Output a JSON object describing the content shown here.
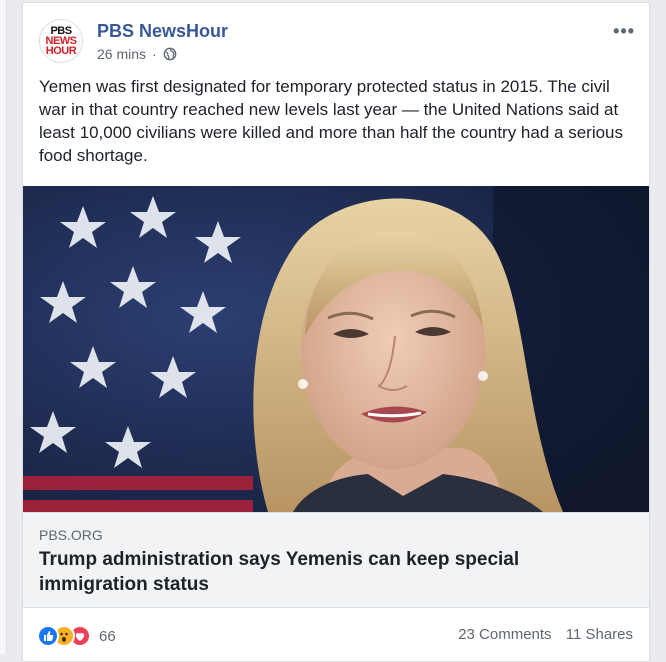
{
  "post": {
    "page_name": "PBS NewsHour",
    "timestamp": "26 mins",
    "separator": "·",
    "privacy_icon": "globe-icon",
    "more_label": "•••",
    "logo": {
      "line1": "PBS",
      "line2": "NEWS",
      "line3": "HOUR"
    },
    "text": "Yemen was first designated for temporary protected status in 2015. The civil war in that country reached new levels last year — the United Nations said at least 10,000 civilians were killed and more than half the country had a serious food shortage."
  },
  "link": {
    "domain": "PBS.ORG",
    "headline": "Trump administration says Yemenis can keep special immigration status"
  },
  "footer": {
    "reaction_icons": [
      "like-icon",
      "wow-icon",
      "love-icon"
    ],
    "reaction_count": "66",
    "comments": "23 Comments",
    "shares": "11 Shares"
  },
  "colors": {
    "link_blue": "#385898",
    "like": "#1877f2",
    "wow": "#f7b125",
    "love": "#f33e58"
  }
}
